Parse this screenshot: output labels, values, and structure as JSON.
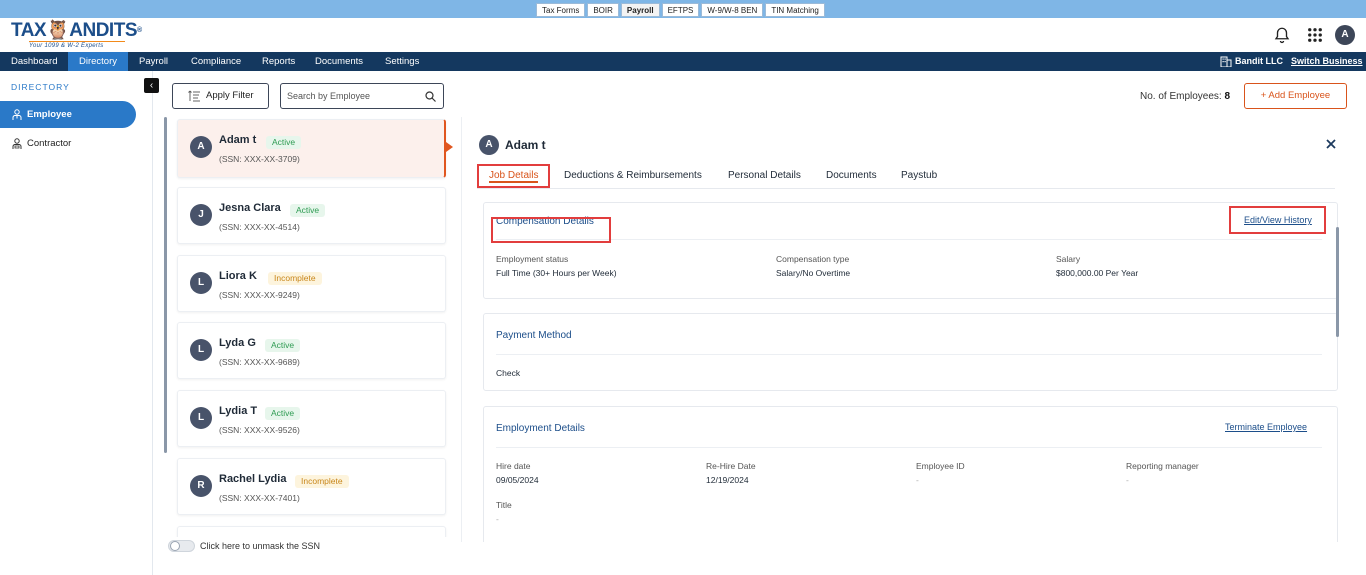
{
  "product_tabs": [
    {
      "label": "Tax Forms"
    },
    {
      "label": "BOIR"
    },
    {
      "label": "Payroll"
    },
    {
      "label": "EFTPS"
    },
    {
      "label": "W-9/W-8 BEN"
    },
    {
      "label": "TIN Matching"
    }
  ],
  "logo": {
    "text_a": "TAX",
    "text_b": "ANDITS",
    "tagline": "Your 1099 & W-2 Experts",
    "registered": "®"
  },
  "header": {
    "avatar_initial": "A"
  },
  "nav": {
    "items": [
      "Dashboard",
      "Directory",
      "Payroll",
      "Compliance",
      "Reports",
      "Documents",
      "Settings"
    ],
    "business_name": "Bandit LLC",
    "switch_business": "Switch Business"
  },
  "sidebar": {
    "title": "DIRECTORY",
    "items": [
      {
        "label": "Employee"
      },
      {
        "label": "Contractor"
      }
    ]
  },
  "toolbar": {
    "apply_filter": "Apply Filter",
    "search_placeholder": "Search by Employee",
    "count_label": "No. of Employees:",
    "count_value": "8",
    "add_employee": "+ Add Employee"
  },
  "employees": [
    {
      "initial": "A",
      "name": "Adam t",
      "status": "Active",
      "ssn": "(SSN: XXX-XX-3709)"
    },
    {
      "initial": "J",
      "name": "Jesna Clara",
      "status": "Active",
      "ssn": "(SSN: XXX-XX-4514)"
    },
    {
      "initial": "L",
      "name": "Liora K",
      "status": "Incomplete",
      "ssn": "(SSN: XXX-XX-9249)"
    },
    {
      "initial": "L",
      "name": "Lyda G",
      "status": "Active",
      "ssn": "(SSN: XXX-XX-9689)"
    },
    {
      "initial": "L",
      "name": "Lydia T",
      "status": "Active",
      "ssn": "(SSN: XXX-XX-9526)"
    },
    {
      "initial": "R",
      "name": "Rachel Lydia",
      "status": "Incomplete",
      "ssn": "(SSN: XXX-XX-7401)"
    }
  ],
  "unmask_label": "Click here to unmask the SSN",
  "detail": {
    "initial": "A",
    "name": "Adam t",
    "tabs": [
      "Job Details",
      "Deductions & Reimbursements",
      "Personal Details",
      "Documents",
      "Paystub"
    ],
    "compensation": {
      "title": "Compensation Details",
      "link": "Edit/View History",
      "fields": [
        {
          "label": "Employment status",
          "value": "Full Time (30+ Hours per Week)"
        },
        {
          "label": "Compensation type",
          "value": "Salary/No Overtime"
        },
        {
          "label": "Salary",
          "value": "$800,000.00 Per Year"
        }
      ]
    },
    "payment": {
      "title": "Payment Method",
      "value": "Check"
    },
    "employment": {
      "title": "Employment Details",
      "link": "Terminate Employee",
      "fields": [
        {
          "label": "Hire date",
          "value": "09/05/2024"
        },
        {
          "label": "Re-Hire Date",
          "value": "12/19/2024"
        },
        {
          "label": "Employee ID",
          "value": "-"
        },
        {
          "label": "Reporting manager",
          "value": "-"
        },
        {
          "label": "Title",
          "value": "-"
        }
      ]
    }
  }
}
